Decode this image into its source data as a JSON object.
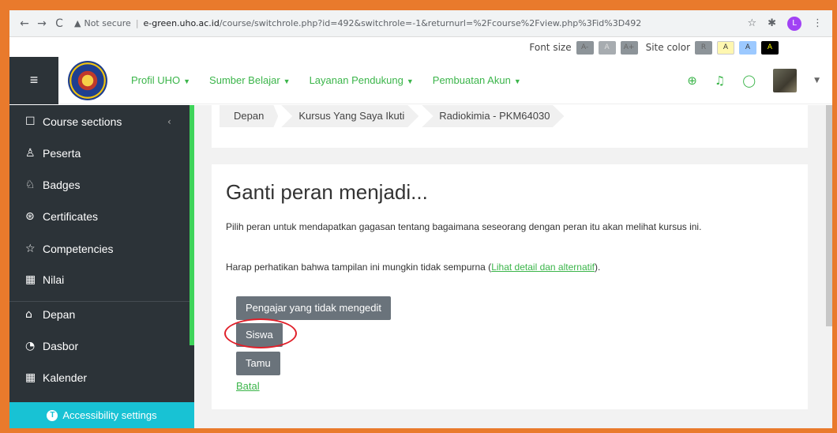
{
  "browser": {
    "back": "←",
    "forward": "→",
    "reload": "C",
    "security": "Not secure",
    "url_host": "e-green.uho.ac.id",
    "url_path": "/course/switchrole.php?id=492&switchrole=-1&returnurl=%2Fcourse%2Fview.php%3Fid%3D492",
    "profile_initial": "L"
  },
  "accessibility_bar": {
    "font_size_label": "Font size",
    "font_buttons": [
      "A-",
      "A",
      "A+"
    ],
    "site_color_label": "Site color",
    "color_buttons": [
      "R",
      "A",
      "A",
      "A"
    ]
  },
  "navbar": {
    "menu": [
      "Profil UHO",
      "Sumber Belajar",
      "Layanan Pendukung",
      "Pembuatan Akun"
    ]
  },
  "sidebar": {
    "items": [
      {
        "label": "Course sections",
        "icon": "folder-icon"
      },
      {
        "label": "Peserta",
        "icon": "users-icon"
      },
      {
        "label": "Badges",
        "icon": "badge-icon"
      },
      {
        "label": "Certificates",
        "icon": "certificate-icon"
      },
      {
        "label": "Competencies",
        "icon": "star-icon"
      },
      {
        "label": "Nilai",
        "icon": "table-icon"
      },
      {
        "label": "Depan",
        "icon": "home-icon"
      },
      {
        "label": "Dasbor",
        "icon": "dashboard-icon"
      },
      {
        "label": "Kalender",
        "icon": "calendar-icon"
      }
    ],
    "accessibility_settings": "Accessibility settings"
  },
  "breadcrumb": [
    "Depan",
    "Kursus Yang Saya Ikuti",
    "Radiokimia - PKM64030"
  ],
  "content": {
    "title": "Ganti peran menjadi...",
    "description": "Pilih peran untuk mendapatkan gagasan tentang bagaimana seseorang dengan peran itu akan melihat kursus ini.",
    "note_prefix": "Harap perhatikan bahwa tampilan ini mungkin tidak sempurna (",
    "note_link": "Lihat detail dan alternatif",
    "note_suffix": ").",
    "buttons": [
      "Pengajar yang tidak mengedit",
      "Siswa",
      "Tamu"
    ],
    "cancel": "Batal"
  },
  "colors": {
    "accent_green": "#3bb54a",
    "sidebar_bg": "#2c3338",
    "frame_orange": "#e97a2c",
    "highlight_red": "#e0202a"
  }
}
